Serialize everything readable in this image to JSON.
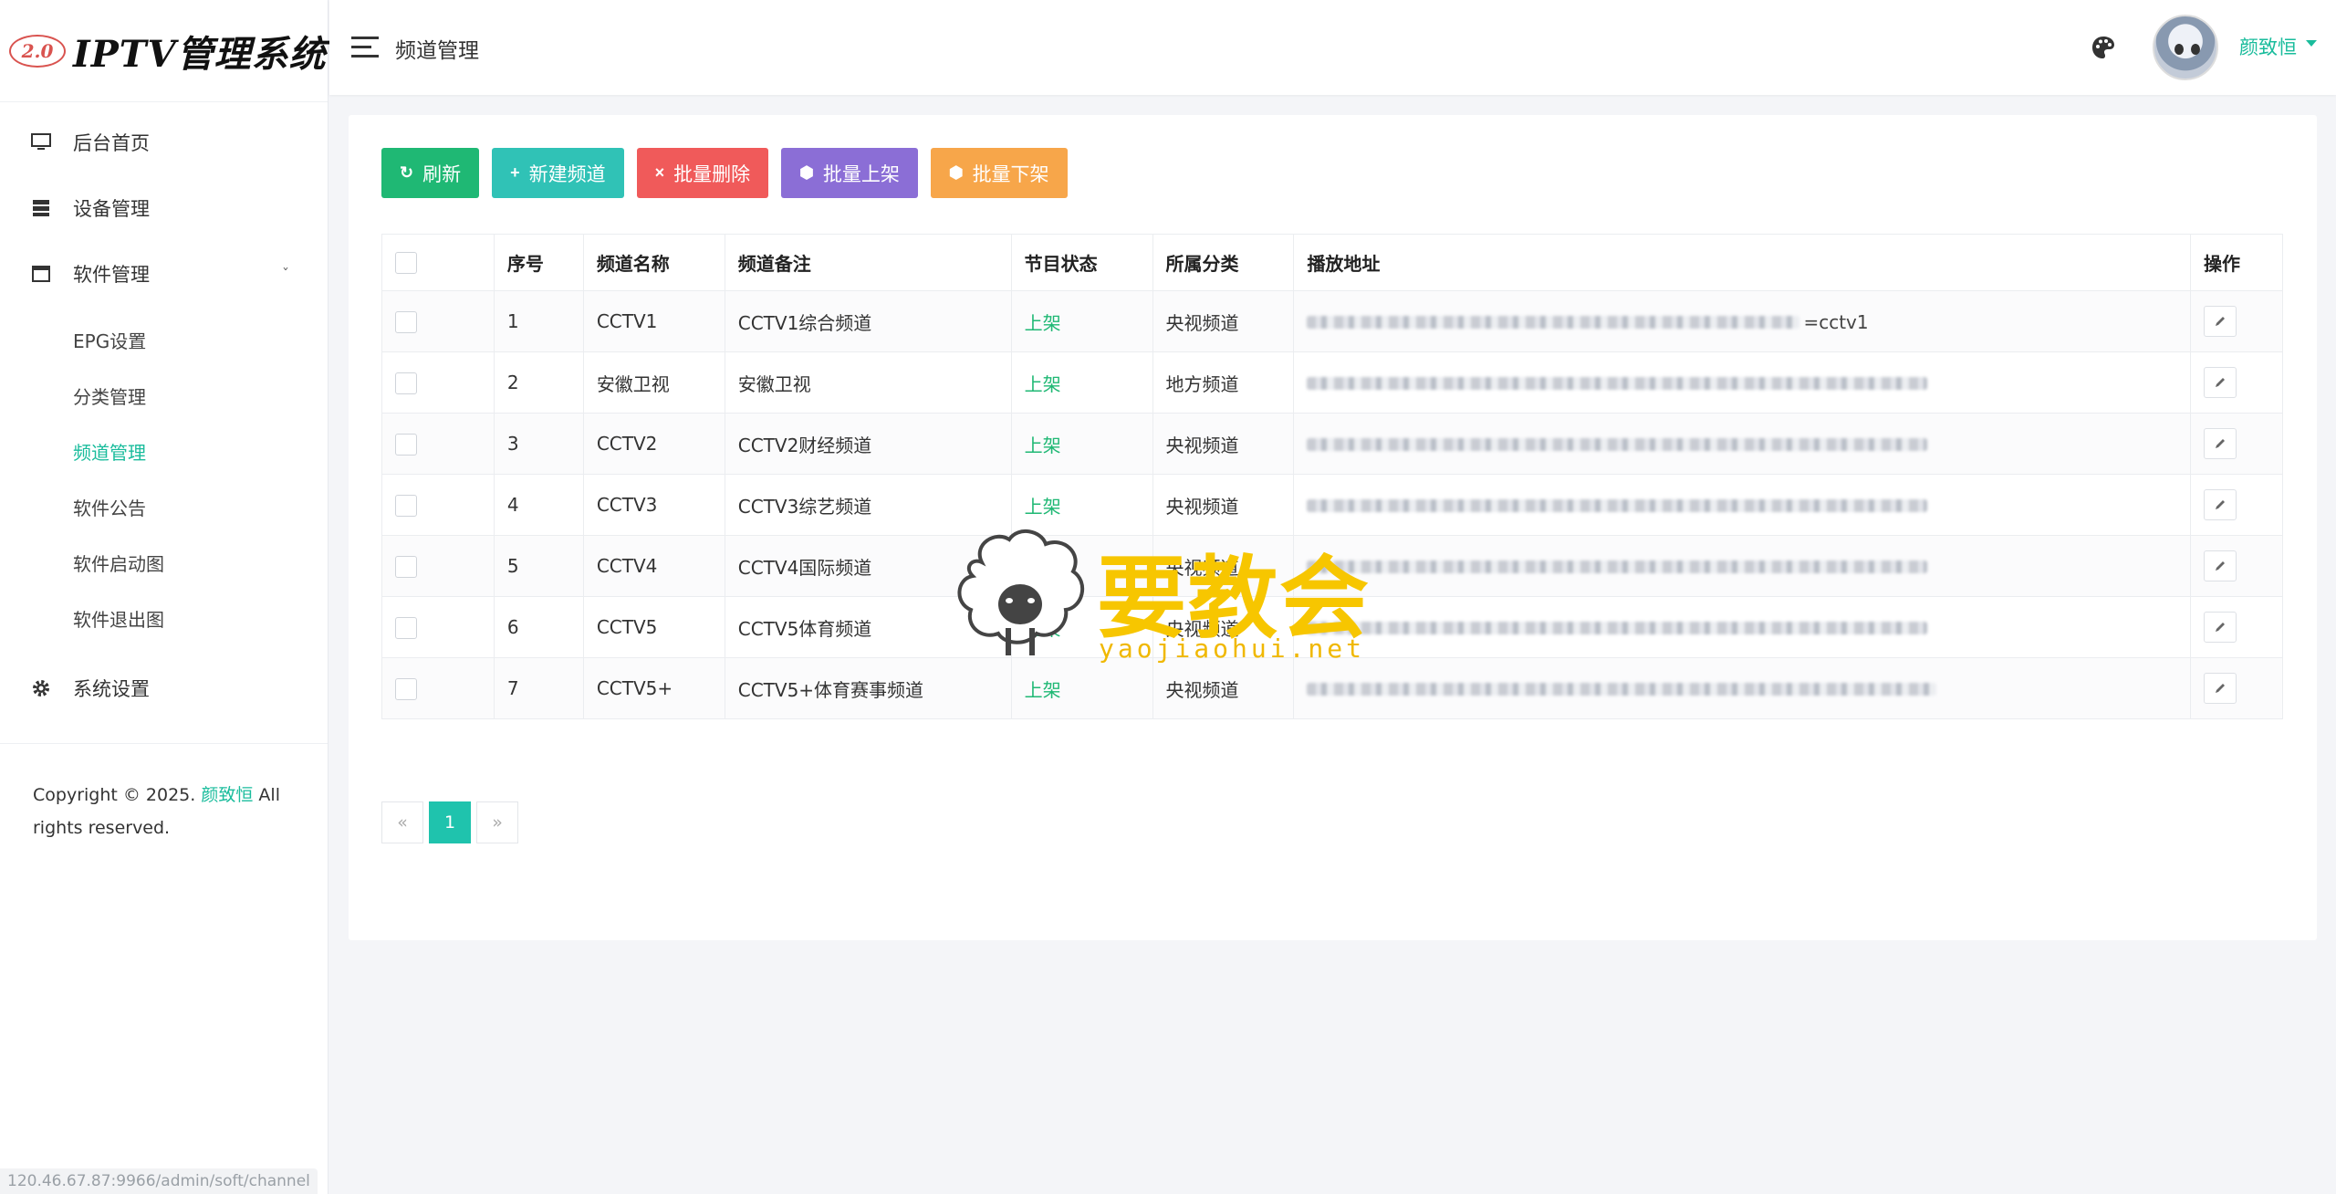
{
  "app": {
    "logo_badge": "2.0",
    "logo_text": "IPTV管理系统"
  },
  "sidebar": {
    "items": [
      {
        "label": "后台首页",
        "icon": "monitor-icon"
      },
      {
        "label": "设备管理",
        "icon": "server-icon"
      },
      {
        "label": "软件管理",
        "icon": "window-icon",
        "expanded": true
      }
    ],
    "submenu": [
      {
        "label": "EPG设置",
        "active": false
      },
      {
        "label": "分类管理",
        "active": false
      },
      {
        "label": "频道管理",
        "active": true
      },
      {
        "label": "软件公告",
        "active": false
      },
      {
        "label": "软件启动图",
        "active": false
      },
      {
        "label": "软件退出图",
        "active": false
      }
    ],
    "settings_label": "系统设置",
    "copyright_prefix": "Copyright © 2025.",
    "copyright_author": "颜致恒",
    "copyright_suffix": "All rights reserved."
  },
  "header": {
    "page_title": "频道管理",
    "username": "颜致恒"
  },
  "toolbar": {
    "refresh": "刷新",
    "new_channel": "新建频道",
    "batch_delete": "批量删除",
    "batch_up": "批量上架",
    "batch_down": "批量下架"
  },
  "table": {
    "headers": [
      "序号",
      "频道名称",
      "频道备注",
      "节目状态",
      "所属分类",
      "播放地址",
      "操作"
    ],
    "rows": [
      {
        "no": "1",
        "name": "CCTV1",
        "note": "CCTV1综合频道",
        "status": "上架",
        "category": "央视频道",
        "url_tail": "=cctv1"
      },
      {
        "no": "2",
        "name": "安徽卫视",
        "note": "安徽卫视",
        "status": "上架",
        "category": "地方频道",
        "url_tail": ""
      },
      {
        "no": "3",
        "name": "CCTV2",
        "note": "CCTV2财经频道",
        "status": "上架",
        "category": "央视频道",
        "url_tail": ""
      },
      {
        "no": "4",
        "name": "CCTV3",
        "note": "CCTV3综艺频道",
        "status": "上架",
        "category": "央视频道",
        "url_tail": ""
      },
      {
        "no": "5",
        "name": "CCTV4",
        "note": "CCTV4国际频道",
        "status": "上架",
        "category": "央视频道",
        "url_tail": ""
      },
      {
        "no": "6",
        "name": "CCTV5",
        "note": "CCTV5体育频道",
        "status": "上架",
        "category": "央视频道",
        "url_tail": ""
      },
      {
        "no": "7",
        "name": "CCTV5+",
        "note": "CCTV5+体育赛事频道",
        "status": "上架",
        "category": "央视频道",
        "url_tail": ""
      }
    ]
  },
  "pagination": {
    "prev": "«",
    "current": "1",
    "next": "»"
  },
  "watermark": {
    "text": "要教会",
    "sub": "yaojiaohui.net"
  },
  "status_bar_url": "120.46.67.87:9966/admin/soft/channel",
  "colors": {
    "accent": "#1abc9c",
    "refresh": "#1fb874",
    "new": "#30c2b6",
    "delete": "#f05a5a",
    "up": "#8b6ed6",
    "down": "#f7a64a"
  }
}
